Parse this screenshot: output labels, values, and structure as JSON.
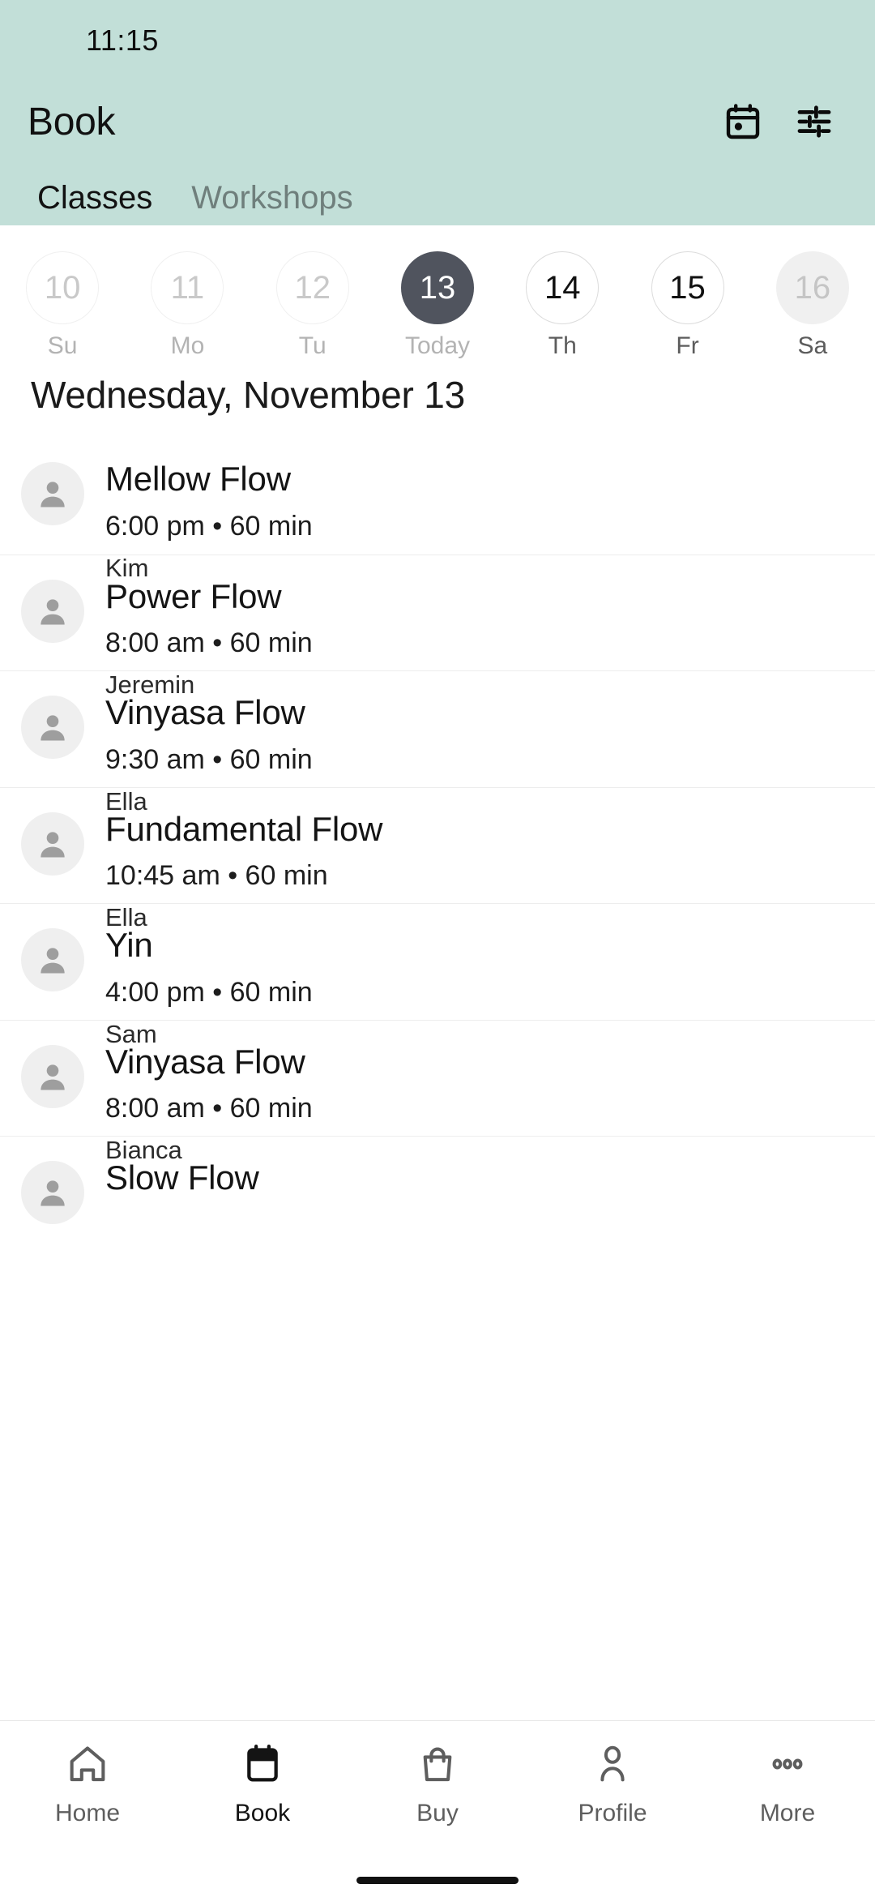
{
  "status_bar": {
    "time": "11:15"
  },
  "app_bar": {
    "title": "Book",
    "actions": [
      {
        "name": "calendar-icon",
        "label": "Calendar"
      },
      {
        "name": "filter-icon",
        "label": "Filters"
      }
    ]
  },
  "tabs": [
    {
      "label": "Classes",
      "active": true
    },
    {
      "label": "Workshops",
      "active": false
    }
  ],
  "date_strip": [
    {
      "day": "10",
      "weekday": "Su",
      "state": "past"
    },
    {
      "day": "11",
      "weekday": "Mo",
      "state": "past"
    },
    {
      "day": "12",
      "weekday": "Tu",
      "state": "past"
    },
    {
      "day": "13",
      "weekday": "Today",
      "state": "today"
    },
    {
      "day": "14",
      "weekday": "Th",
      "state": "future"
    },
    {
      "day": "15",
      "weekday": "Fr",
      "state": "future"
    },
    {
      "day": "16",
      "weekday": "Sa",
      "state": "disabled"
    }
  ],
  "date_heading": "Wednesday, November 13",
  "classes": [
    {
      "title": "Mellow Flow",
      "meta": "6:00 pm • 60 min",
      "instructor": "Kim"
    },
    {
      "title": "Power Flow",
      "meta": "8:00 am • 60 min",
      "instructor": "Jeremin"
    },
    {
      "title": "Vinyasa Flow",
      "meta": "9:30 am • 60 min",
      "instructor": "Ella"
    },
    {
      "title": "Fundamental Flow",
      "meta": "10:45 am • 60 min",
      "instructor": "Ella"
    },
    {
      "title": "Yin",
      "meta": "4:00 pm • 60 min",
      "instructor": "Sam"
    },
    {
      "title": "Vinyasa Flow",
      "meta": "8:00 am • 60 min",
      "instructor": "Bianca"
    },
    {
      "title": "Slow Flow",
      "meta": "",
      "instructor": ""
    }
  ],
  "bottom_nav": [
    {
      "label": "Home",
      "icon": "home-icon",
      "active": false
    },
    {
      "label": "Book",
      "icon": "calendar-icon",
      "active": true
    },
    {
      "label": "Buy",
      "icon": "bag-icon",
      "active": false
    },
    {
      "label": "Profile",
      "icon": "person-icon",
      "active": false
    },
    {
      "label": "More",
      "icon": "ellipsis-icon",
      "active": false
    }
  ],
  "colors": {
    "header_teal": "#c2dfd8",
    "today_circle": "#50545e",
    "disabled_circle": "#f0f0f0",
    "avatar_bg": "#efefef",
    "avatar_fg": "#9e9e9e"
  }
}
